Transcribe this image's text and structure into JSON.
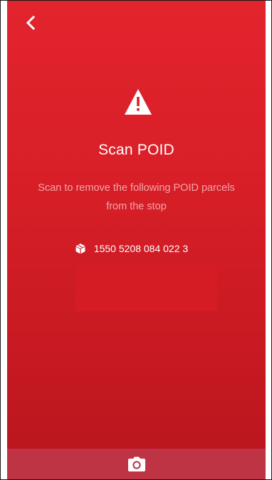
{
  "header": {
    "back_icon": "chevron-left-icon"
  },
  "main": {
    "warning_icon": "warning-triangle-icon",
    "title": "Scan POID",
    "subtitle": "Scan to remove the following POID parcels from the stop",
    "parcel_icon": "box-icon",
    "parcels": [
      {
        "id": "1550 5208 084 022 3"
      }
    ]
  },
  "footer": {
    "camera_icon": "camera-icon"
  },
  "colors": {
    "background": "#dc2029",
    "bottom_bar": "#bf3445",
    "subtitle_text": "#f3a4a7",
    "text": "#ffffff"
  }
}
